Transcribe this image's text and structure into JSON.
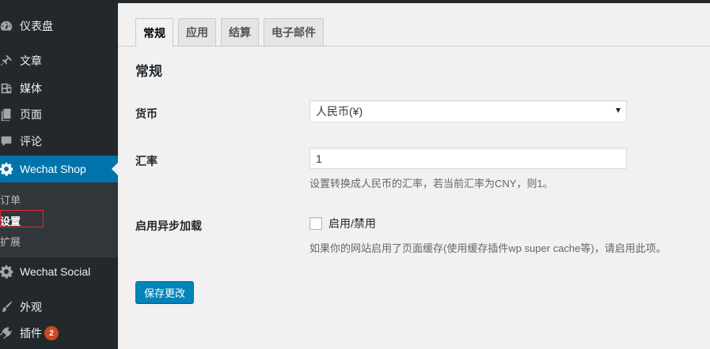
{
  "sidebar": {
    "items": [
      {
        "label": "仪表盘",
        "icon": "dashboard-icon"
      },
      {
        "label": "文章",
        "icon": "pushpin-icon"
      },
      {
        "label": "媒体",
        "icon": "media-icon"
      },
      {
        "label": "页面",
        "icon": "page-icon"
      },
      {
        "label": "评论",
        "icon": "comment-icon"
      },
      {
        "label": "Wechat Shop",
        "icon": "gear-icon",
        "active": true
      },
      {
        "label": "Wechat Social",
        "icon": "gear-icon"
      },
      {
        "label": "外观",
        "icon": "paintbrush-icon"
      },
      {
        "label": "插件",
        "icon": "plugin-icon",
        "badge": "2"
      }
    ],
    "submenu": [
      {
        "label": "订单"
      },
      {
        "label": "设置",
        "current": true
      },
      {
        "label": "扩展"
      }
    ]
  },
  "tabs": [
    {
      "label": "常规",
      "active": true
    },
    {
      "label": "应用"
    },
    {
      "label": "结算"
    },
    {
      "label": "电子邮件"
    }
  ],
  "main": {
    "section_title": "常规",
    "currency": {
      "label": "货币",
      "selected": "人民币(¥)"
    },
    "exchange_rate": {
      "label": "汇率",
      "value": "1",
      "description": "设置转换成人民币的汇率，若当前汇率为CNY，则1。"
    },
    "async": {
      "label": "启用异步加载",
      "checkbox_label": "启用/禁用",
      "checked": false,
      "description": "如果你的网站启用了页面缓存(使用缓存插件wp super cache等)，请启用此项。"
    },
    "save_label": "保存更改"
  },
  "colors": {
    "sidebar_bg": "#23282d",
    "active_bg": "#0073aa",
    "primary_button": "#0085ba",
    "badge": "#ca4a1f"
  }
}
